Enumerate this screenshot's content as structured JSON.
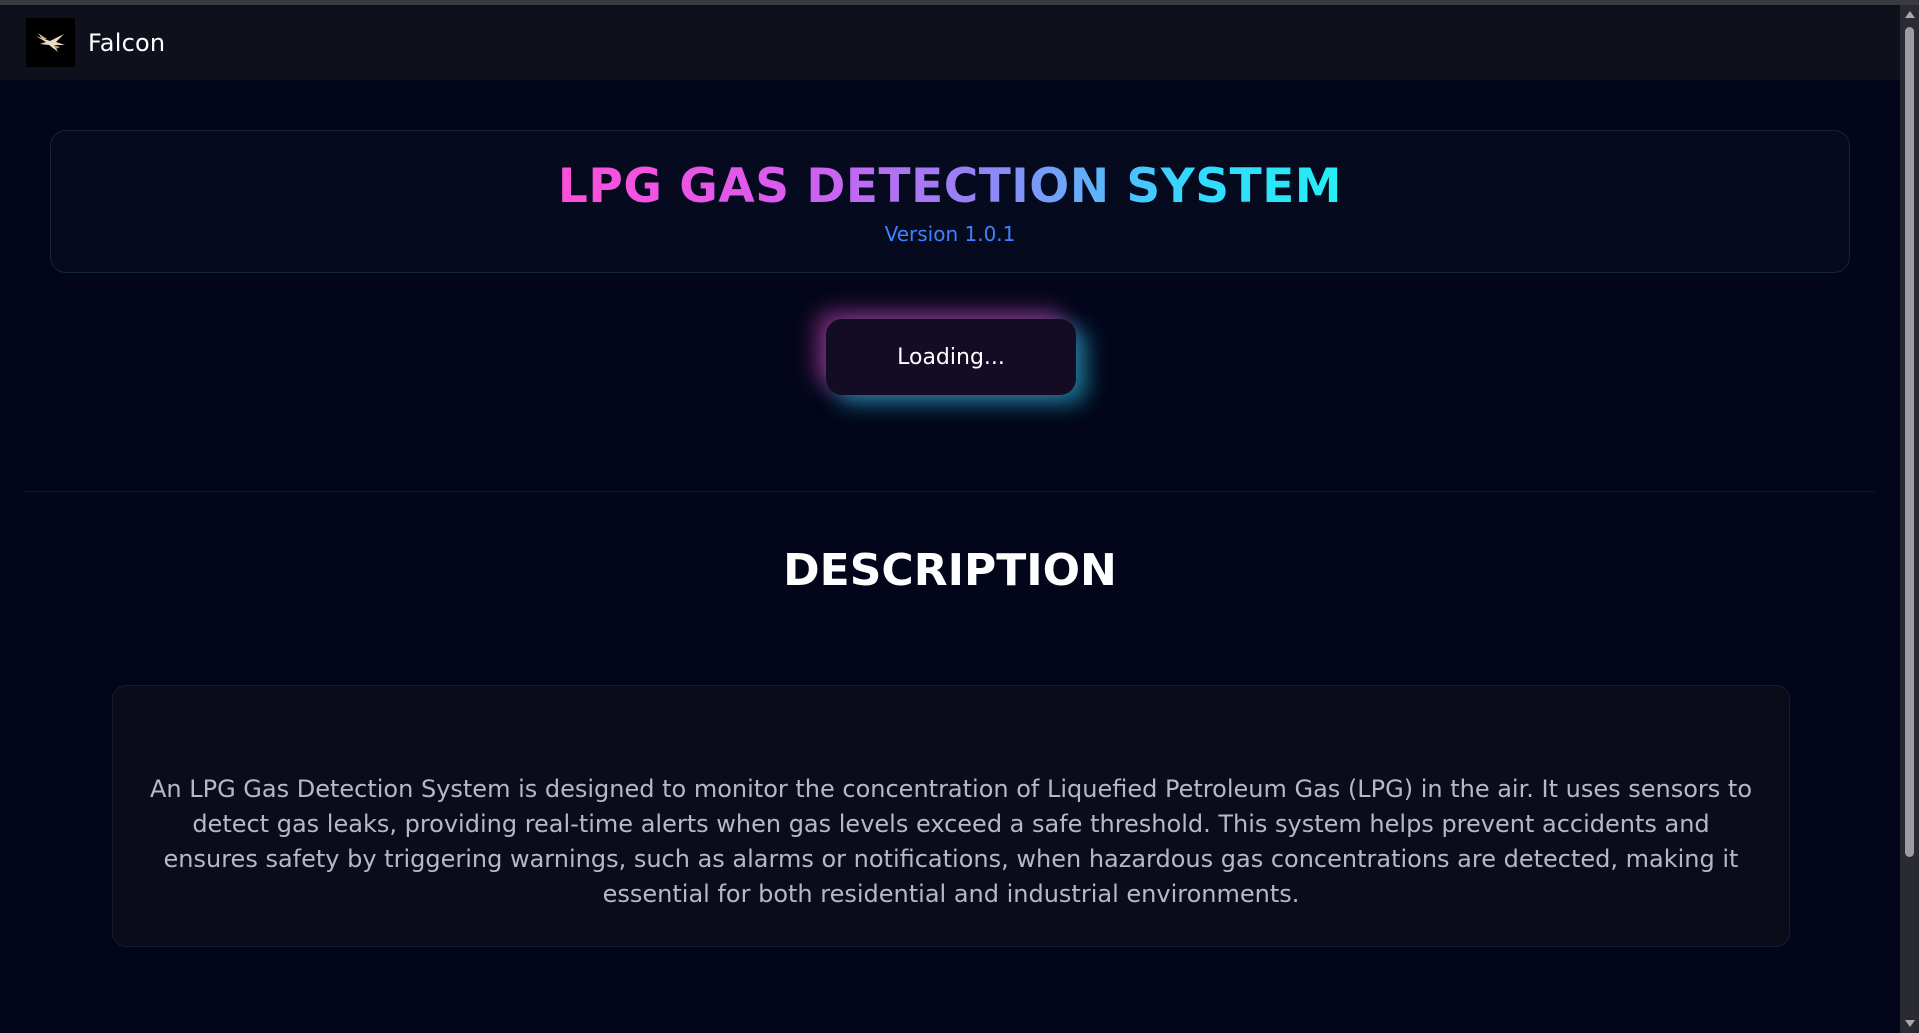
{
  "navbar": {
    "brand": "Falcon",
    "logo_icon": "falcon-logo-icon"
  },
  "header": {
    "title": "LPG GAS DETECTION SYSTEM",
    "version": "Version 1.0.1"
  },
  "status_button": {
    "label": "Loading..."
  },
  "description": {
    "title": "DESCRIPTION",
    "text": "An LPG Gas Detection System is designed to monitor the concentration of Liquefied Petroleum Gas (LPG) in the air. It uses sensors to detect gas leaks, providing real-time alerts when gas levels exceed a safe threshold. This system helps prevent accidents and ensures safety by triggering warnings, such as alarms or notifications, when hazardous gas concentrations are detected, making it essential for both residential and industrial environments."
  },
  "colors": {
    "background": "#03061a",
    "navbar": "#0e111c",
    "title_gradient_start": "#ff4fd8",
    "title_gradient_end": "#22f0f3",
    "version": "#3f82ff",
    "glow_pink": "#ff50dc",
    "glow_cyan": "#28dcff"
  }
}
